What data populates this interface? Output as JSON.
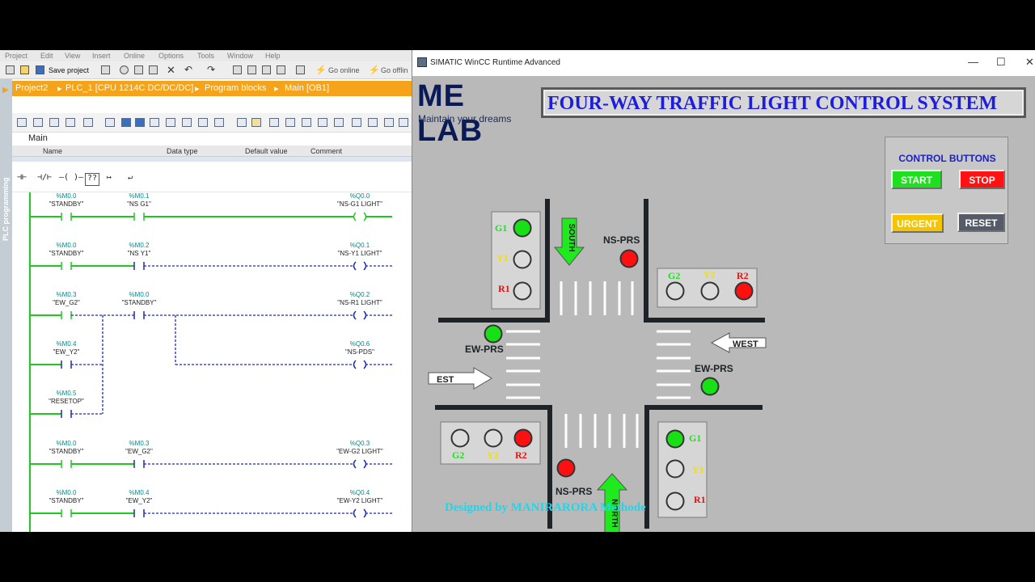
{
  "tia": {
    "menu": [
      "Project",
      "Edit",
      "View",
      "Insert",
      "Online",
      "Options",
      "Tools",
      "Window",
      "Help"
    ],
    "toolbar": {
      "save_label": "Save project",
      "go_online": "Go online",
      "go_offline": "Go offlin"
    },
    "breadcrumb": [
      "Project2",
      "PLC_1 [CPU 1214C DC/DC/DC]",
      "Program blocks",
      "Main [OB1]"
    ],
    "side_tab": "PLC programming",
    "block_title": "Main",
    "interface_columns": [
      "Name",
      "Data type",
      "Default value",
      "Comment"
    ],
    "ladder_buttons": [
      "⊣⊢",
      "⊣/⊢",
      "–( )–",
      "??",
      "↦",
      "↵"
    ],
    "networks": [
      {
        "contacts": [
          {
            "addr": "%M0.0",
            "tag": "\"STANDBY\""
          },
          {
            "addr": "%M0.1",
            "tag": "\"NS G1\""
          }
        ],
        "coil": {
          "addr": "%Q0.0",
          "tag": "\"NS-G1 LIGHT\""
        },
        "energized": true
      },
      {
        "contacts": [
          {
            "addr": "%M0.0",
            "tag": "\"STANDBY\""
          },
          {
            "addr": "%M0.2",
            "tag": "\"NS Y1\""
          }
        ],
        "coil": {
          "addr": "%Q0.1",
          "tag": "\"NS-Y1 LIGHT\""
        },
        "energized": false
      },
      {
        "contacts": [
          {
            "addr": "%M0.3",
            "tag": "\"EW_G2\""
          },
          {
            "addr": "%M0.0",
            "tag": "\"STANDBY\""
          }
        ],
        "coil": {
          "addr": "%Q0.2",
          "tag": "\"NS-R1 LIGHT\""
        },
        "energized": false,
        "branch_contacts": [
          {
            "addr": "%M0.4",
            "tag": "\"EW_Y2\""
          },
          {
            "addr": "%M0.5",
            "tag": "\"RESETOP\""
          }
        ],
        "branch_coil": {
          "addr": "%Q0.6",
          "tag": "\"NS-PDS\""
        }
      },
      {
        "contacts": [
          {
            "addr": "%M0.0",
            "tag": "\"STANDBY\""
          },
          {
            "addr": "%M0.3",
            "tag": "\"EW_G2\""
          }
        ],
        "coil": {
          "addr": "%Q0.3",
          "tag": "\"EW-G2 LIGHT\""
        },
        "energized": false
      },
      {
        "contacts": [
          {
            "addr": "%M0.0",
            "tag": "\"STANDBY\""
          },
          {
            "addr": "%M0.4",
            "tag": "\"EW_Y2\""
          }
        ],
        "coil": {
          "addr": "%Q0.4",
          "tag": "\"EW-Y2 LIGHT\""
        },
        "energized": false
      }
    ]
  },
  "wincc": {
    "window_title": "SIMATIC WinCC Runtime Advanced",
    "logo": {
      "main": "ME LAB",
      "sub": "Maintain your dreams"
    },
    "title": "FOUR-WAY TRAFFIC LIGHT CONTROL SYSTEM",
    "control_panel": {
      "title": "CONTROL BUTTONS",
      "start": "START",
      "stop": "STOP",
      "urgent": "URGENT",
      "reset": "RESET"
    },
    "designer": "Designed by MANIRARORA Methode",
    "directions": {
      "south": "SOUTH",
      "north": "NORTH",
      "west": "WEST",
      "east": "EST"
    },
    "ped_labels": {
      "ns": "NS-PRS",
      "ew": "EW-PRS"
    },
    "light_labels": {
      "g1": "G1",
      "y1": "Y1",
      "r1": "R1",
      "g2": "G2",
      "y2": "Y2",
      "r2": "R2"
    },
    "colors": {
      "green_on": "#17e017",
      "red_on": "#ff1010",
      "off": "#dcdcdc",
      "green_text": "#23e023",
      "yellow_text": "#f0e000",
      "red_text": "#e81010"
    },
    "lamp_states": {
      "north_west_box": {
        "G1": "on",
        "Y1": "off",
        "R1": "off"
      },
      "north_east_box": {
        "G2": "off",
        "Y2": "off",
        "R2": "on"
      },
      "south_west_box": {
        "G2": "off",
        "Y2": "off",
        "R2": "on"
      },
      "south_east_box": {
        "G1": "on",
        "Y1": "off",
        "R1": "off"
      },
      "ped_ns_top": "red",
      "ped_ns_bottom": "red",
      "ped_ew_left": "green",
      "ped_ew_right": "green"
    }
  }
}
